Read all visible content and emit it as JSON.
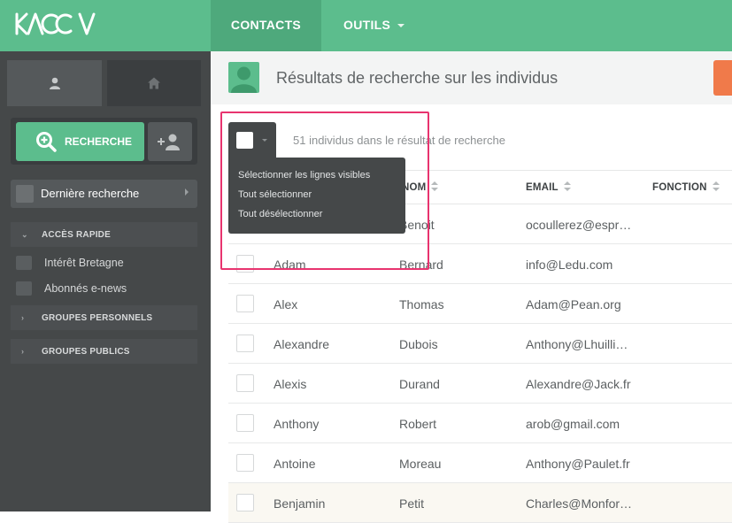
{
  "app": {
    "logo_text": "KACCA"
  },
  "topnav": {
    "contacts": "CONTACTS",
    "outils": "OUTILS"
  },
  "sidebar": {
    "search_button": "RECHERCHE",
    "last_search": "Dernière recherche",
    "quick_access": "ACCÈS RAPIDE",
    "items": [
      "Intérêt Bretagne",
      "Abonnés e-news"
    ],
    "personal_groups": "GROUPES PERSONNELS",
    "public_groups": "GROUPES PUBLICS"
  },
  "main": {
    "title": "Résultats de recherche sur les individus",
    "count": "51 individus dans le résultat de recherche"
  },
  "dropdown": {
    "items": [
      "Sélectionner les lignes visibles",
      "Tout sélectionner",
      "Tout désélectionner"
    ]
  },
  "table": {
    "headers": {
      "nom": "NOM",
      "email": "EMAIL",
      "fonction": "FONCTION"
    },
    "rows": [
      {
        "prenom": "",
        "nom": "Benoit",
        "email": "ocoullerez@espr…"
      },
      {
        "prenom": "Adam",
        "nom": "Bernard",
        "email": "info@Ledu.com"
      },
      {
        "prenom": "Alex",
        "nom": "Thomas",
        "email": "Adam@Pean.org"
      },
      {
        "prenom": "Alexandre",
        "nom": "Dubois",
        "email": "Anthony@Lhuilli…"
      },
      {
        "prenom": "Alexis",
        "nom": "Durand",
        "email": "Alexandre@Jack.fr"
      },
      {
        "prenom": "Anthony",
        "nom": "Robert",
        "email": "arob@gmail.com"
      },
      {
        "prenom": "Antoine",
        "nom": "Moreau",
        "email": "Anthony@Paulet.fr"
      },
      {
        "prenom": "Benjamin",
        "nom": "Petit",
        "email": "Charles@Monfor…"
      }
    ]
  },
  "colors": {
    "brand": "#5cbd8d",
    "sidebar": "#454849",
    "highlight": "#e8346f",
    "export": "#f07a4a"
  }
}
